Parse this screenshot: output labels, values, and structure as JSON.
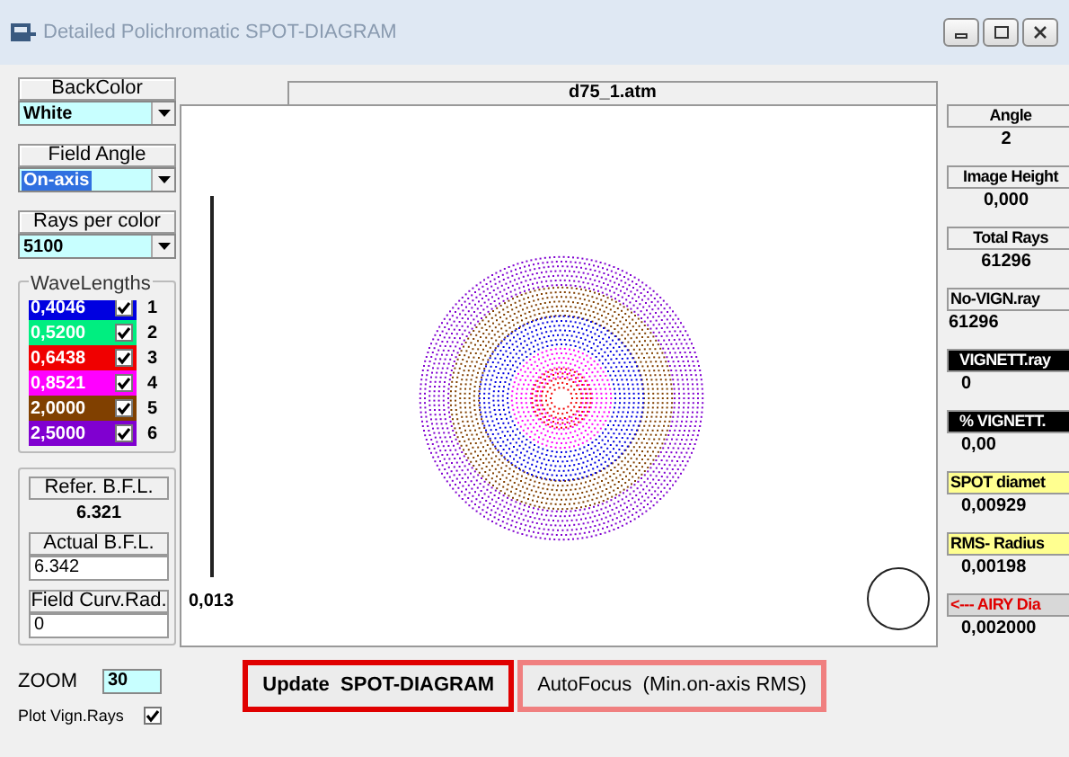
{
  "window": {
    "title": "Detailed Polichromatic SPOT-DIAGRAM"
  },
  "left_panel": {
    "combos": [
      {
        "label": "BackColor",
        "value": "White",
        "highlighted": false
      },
      {
        "label": "Field Angle",
        "value": "On-axis",
        "highlighted": true
      },
      {
        "label": "Rays per color",
        "value": "5100",
        "highlighted": false
      }
    ],
    "wavelengths": {
      "title": "WaveLengths",
      "items": [
        {
          "value": "0,4046",
          "color": "#0000e0",
          "checked": true,
          "number": "1"
        },
        {
          "value": "0,5200",
          "color": "#00ee80",
          "checked": true,
          "number": "2"
        },
        {
          "value": "0,6438",
          "color": "#f00000",
          "checked": true,
          "number": "3"
        },
        {
          "value": "0,8521",
          "color": "#ff00ff",
          "checked": true,
          "number": "4"
        },
        {
          "value": "2,0000",
          "color": "#804000",
          "checked": true,
          "number": "5"
        },
        {
          "value": "2,5000",
          "color": "#8000d0",
          "checked": true,
          "number": "6"
        }
      ]
    },
    "bfl": {
      "refer_label": "Refer.  B.F.L.",
      "refer_value": "6.321",
      "actual_label": "Actual B.F.L.",
      "actual_value": "6.342",
      "curv_label": "Field Curv.Rad.",
      "curv_value": "0"
    },
    "zoom": {
      "label": "ZOOM",
      "value": "30"
    },
    "plot_vign": {
      "label": "Plot Vign.Rays",
      "checked": true
    }
  },
  "plot": {
    "title": "d75_1.atm",
    "scale_label": "0,013"
  },
  "buttons": [
    {
      "label": "Update  SPOT-DIAGRAM",
      "color": "#e00000",
      "bold": true
    },
    {
      "label": "AutoFocus  (Min.on-axis RMS)",
      "color": "#f08080",
      "bold": false
    }
  ],
  "results": [
    {
      "label": "Angle",
      "value": "2",
      "kind": "plain"
    },
    {
      "label": "Image Height",
      "value": "0,000",
      "kind": "plain"
    },
    {
      "label": "Total Rays",
      "value": "61296",
      "kind": "plain"
    },
    {
      "label": "No-VIGN.ray",
      "value": "61296",
      "kind": "plain-left"
    },
    {
      "label": "VIGNETT.ray",
      "value": "0",
      "kind": "dark"
    },
    {
      "label": "% VIGNETT.",
      "value": "0,00",
      "kind": "dark"
    },
    {
      "label": "SPOT diamet",
      "value": "0,00929",
      "kind": "yellow"
    },
    {
      "label": "RMS- Radius",
      "value": "0,00198",
      "kind": "yellow"
    },
    {
      "label": "<--- AIRY Dia",
      "value": "0,002000",
      "kind": "red"
    }
  ]
}
